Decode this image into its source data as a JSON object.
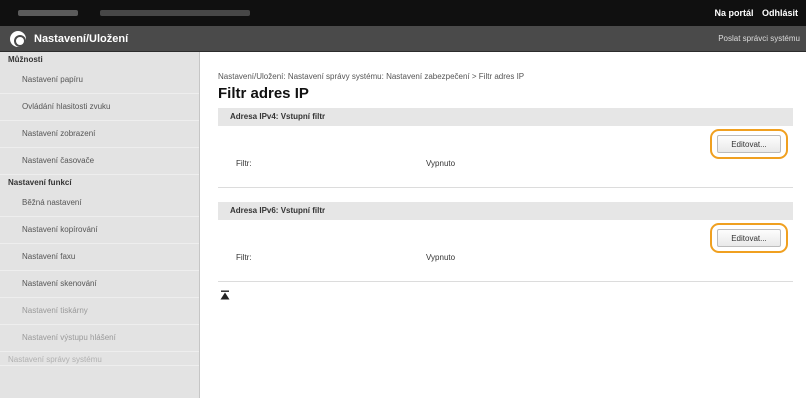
{
  "topbar": {
    "portal_link": "Na portál",
    "logout_link": "Odhlásit"
  },
  "header": {
    "title": "Nastavení/Uložení",
    "admin_link": "Poslat správci systému"
  },
  "sidebar": {
    "section_preferences": "Můžnosti",
    "items_preferences": [
      "Nastavení papíru",
      "Ovládání hlasitosti zvuku",
      "Nastavení zobrazení",
      "Nastavení časovače"
    ],
    "section_functions": "Nastavení funkcí",
    "items_functions": [
      "Běžná nastavení",
      "Nastavení kopírování",
      "Nastavení faxu",
      "Nastavení skenování",
      "Nastavení tiskárny",
      "Nastavení výstupu hlášení"
    ],
    "cut_item": "Nastavení správy systému"
  },
  "main": {
    "breadcrumb": "Nastavení/Uložení: Nastavení správy systému: Nastavení zabezpečení > Filtr adres IP",
    "title": "Filtr adres IP",
    "sections": [
      {
        "heading": "Adresa IPv4: Vstupní filtr",
        "edit_label": "Editovat...",
        "filter_label": "Filtr:",
        "filter_value": "Vypnuto"
      },
      {
        "heading": "Adresa IPv6: Vstupní filtr",
        "edit_label": "Editovat...",
        "filter_label": "Filtr:",
        "filter_value": "Vypnuto"
      }
    ]
  },
  "colors": {
    "highlight": "#f0a020",
    "topbar": "#101010",
    "titlebar": "#4a4a4a",
    "sidebar": "#e3e3e3"
  },
  "icons": {
    "header": "settings-register-icon",
    "back_to_top": "back-to-top-icon"
  }
}
